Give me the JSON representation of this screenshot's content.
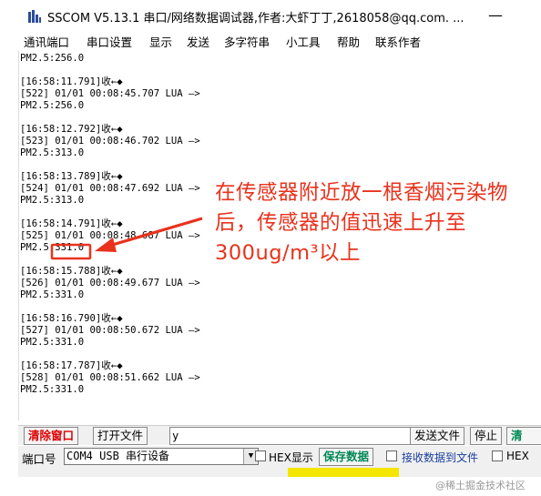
{
  "window": {
    "title": "SSCOM V5.13.1 串口/网络数据调试器,作者:大虾丁丁,2618058@qq.com. ...",
    "minimize_glyph": "—"
  },
  "menu": [
    "通讯端口",
    "串口设置",
    "显示",
    "发送",
    "多字符串",
    "小工具",
    "帮助",
    "联系作者"
  ],
  "log_lines": [
    "PM2.5:256.0",
    "",
    "[16:58:11.791]收←◆",
    "[522] 01/01 00:08:45.707 LUA —>",
    "PM2.5:256.0",
    "",
    "[16:58:12.792]收←◆",
    "[523] 01/01 00:08:46.702 LUA —>",
    "PM2.5:313.0",
    "",
    "[16:58:13.789]收←◆",
    "[524] 01/01 00:08:47.692 LUA —>",
    "PM2.5:313.0",
    "",
    "[16:58:14.791]收←◆",
    "[525] 01/01 00:08:48.687 LUA —>",
    "PM2.5:331.0",
    "",
    "[16:58:15.788]收←◆",
    "[526] 01/01 00:08:49.677 LUA —>",
    "PM2.5:331.0",
    "",
    "[16:58:16.790]收←◆",
    "[527] 01/01 00:08:50.672 LUA —>",
    "PM2.5:331.0",
    "",
    "[16:58:17.787]收←◆",
    "[528] 01/01 00:08:51.662 LUA —>",
    "PM2.5:331.0"
  ],
  "annotation": {
    "text": "在传感器附近放一根香烟污染物后，传感器的值迅速上升至300ug/m³以上",
    "color": "#e8321c"
  },
  "toolbar1": {
    "clear_label": "清除窗口",
    "open_file_label": "打开文件",
    "input_value": "y",
    "send_file_label": "发送文件",
    "stop_label": "停止",
    "partial_label": "清"
  },
  "toolbar2": {
    "port_label": "端口号",
    "port_value": "COM4 USB 串行设备",
    "hex_display_label": "HEX显示",
    "save_data_label": "保存数据",
    "receive_to_file_label": "接收数据到文件",
    "hex_partial_label": "HEX"
  },
  "watermark": "@稀土掘金技术社区"
}
